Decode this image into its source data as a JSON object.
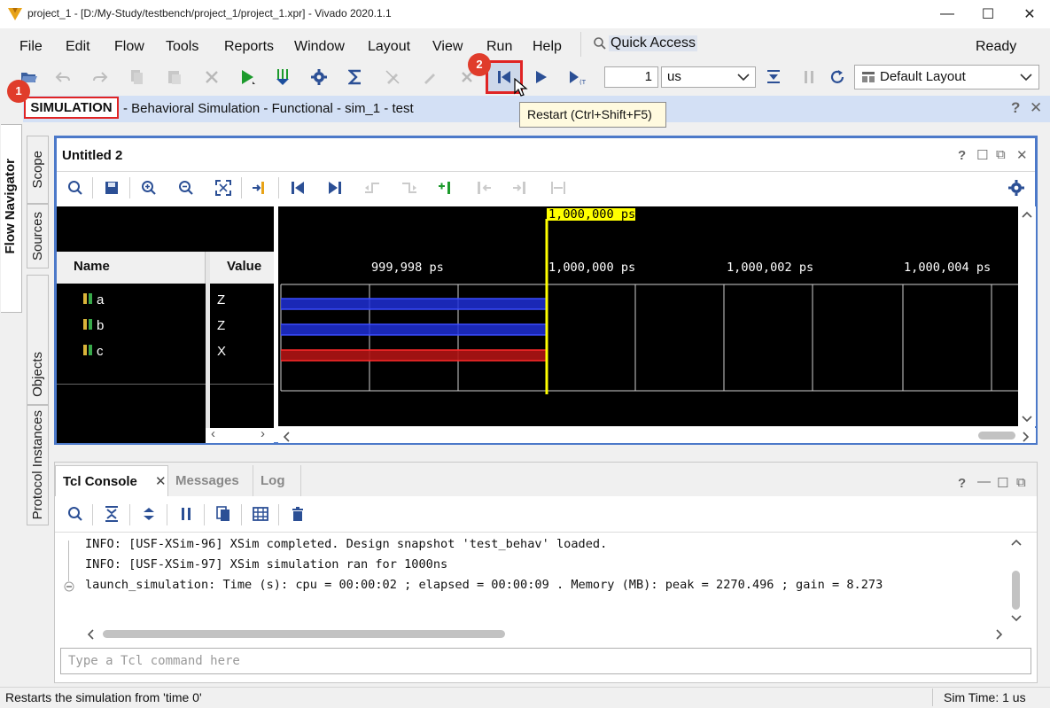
{
  "window": {
    "title": "project_1 - [D:/My-Study/testbench/project_1/project_1.xpr] - Vivado 2020.1.1",
    "minimize": "—",
    "maximize": "☐",
    "close": "✕"
  },
  "menu": {
    "items": [
      "File",
      "Edit",
      "Flow",
      "Tools",
      "Reports",
      "Window",
      "Layout",
      "View",
      "Run",
      "Help"
    ],
    "quick_access": "Quick Access",
    "status": "Ready"
  },
  "toolbar": {
    "run_time_value": "1",
    "run_time_unit": "us",
    "layout": "Default Layout"
  },
  "simulation": {
    "label": "SIMULATION",
    "subtitle": "- Behavioral Simulation - Functional - sim_1 - test"
  },
  "tooltip": "Restart (Ctrl+Shift+F5)",
  "badges": [
    "1",
    "2"
  ],
  "sidebar": {
    "flow_navigator": "Flow Navigator",
    "tabs": [
      "Scope",
      "Sources",
      "Objects",
      "Protocol Instances"
    ]
  },
  "wave": {
    "title": "Untitled 2",
    "name_header": "Name",
    "value_header": "Value",
    "cursor_label": "1,000,000 ps",
    "time_ticks": [
      "999,998 ps",
      "1,000,000 ps",
      "1,000,002 ps",
      "1,000,004 ps"
    ],
    "signals": [
      {
        "name": "a",
        "value": "Z",
        "color": "#1f2fd6"
      },
      {
        "name": "b",
        "value": "Z",
        "color": "#1f2fd6"
      },
      {
        "name": "c",
        "value": "X",
        "color": "#d81818"
      }
    ]
  },
  "console": {
    "tabs": [
      "Tcl Console",
      "Messages",
      "Log"
    ],
    "lines": [
      "INFO: [USF-XSim-96] XSim completed. Design snapshot 'test_behav' loaded.",
      "INFO: [USF-XSim-97] XSim simulation ran for 1000ns",
      "launch_simulation: Time (s): cpu = 00:00:02 ; elapsed = 00:00:09 . Memory (MB): peak = 2270.496 ; gain = 8.273"
    ],
    "input_placeholder": "Type a Tcl command here"
  },
  "statusbar": {
    "message": "Restarts the simulation from 'time 0'",
    "sim_time": "Sim Time: 1 us"
  },
  "colors": {
    "accent_blue": "#4c79c9",
    "highlight_red": "#e02424",
    "cursor_yellow": "#ffff00"
  }
}
